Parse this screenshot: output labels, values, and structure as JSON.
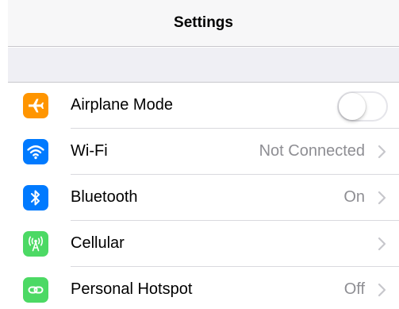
{
  "header": {
    "title": "Settings"
  },
  "colors": {
    "airplane": "#ff9500",
    "wifi": "#007aff",
    "bluetooth": "#007aff",
    "cellular": "#4cd964",
    "hotspot": "#4cd964"
  },
  "rows": [
    {
      "label": "Airplane Mode",
      "icon": "airplane-icon",
      "control": "toggle",
      "toggle_on": false
    },
    {
      "label": "Wi-Fi",
      "icon": "wifi-icon",
      "value": "Not Connected",
      "control": "chevron"
    },
    {
      "label": "Bluetooth",
      "icon": "bluetooth-icon",
      "value": "On",
      "control": "chevron"
    },
    {
      "label": "Cellular",
      "icon": "cellular-antenna-icon",
      "value": "",
      "control": "chevron"
    },
    {
      "label": "Personal Hotspot",
      "icon": "hotspot-icon",
      "value": "Off",
      "control": "chevron"
    }
  ]
}
